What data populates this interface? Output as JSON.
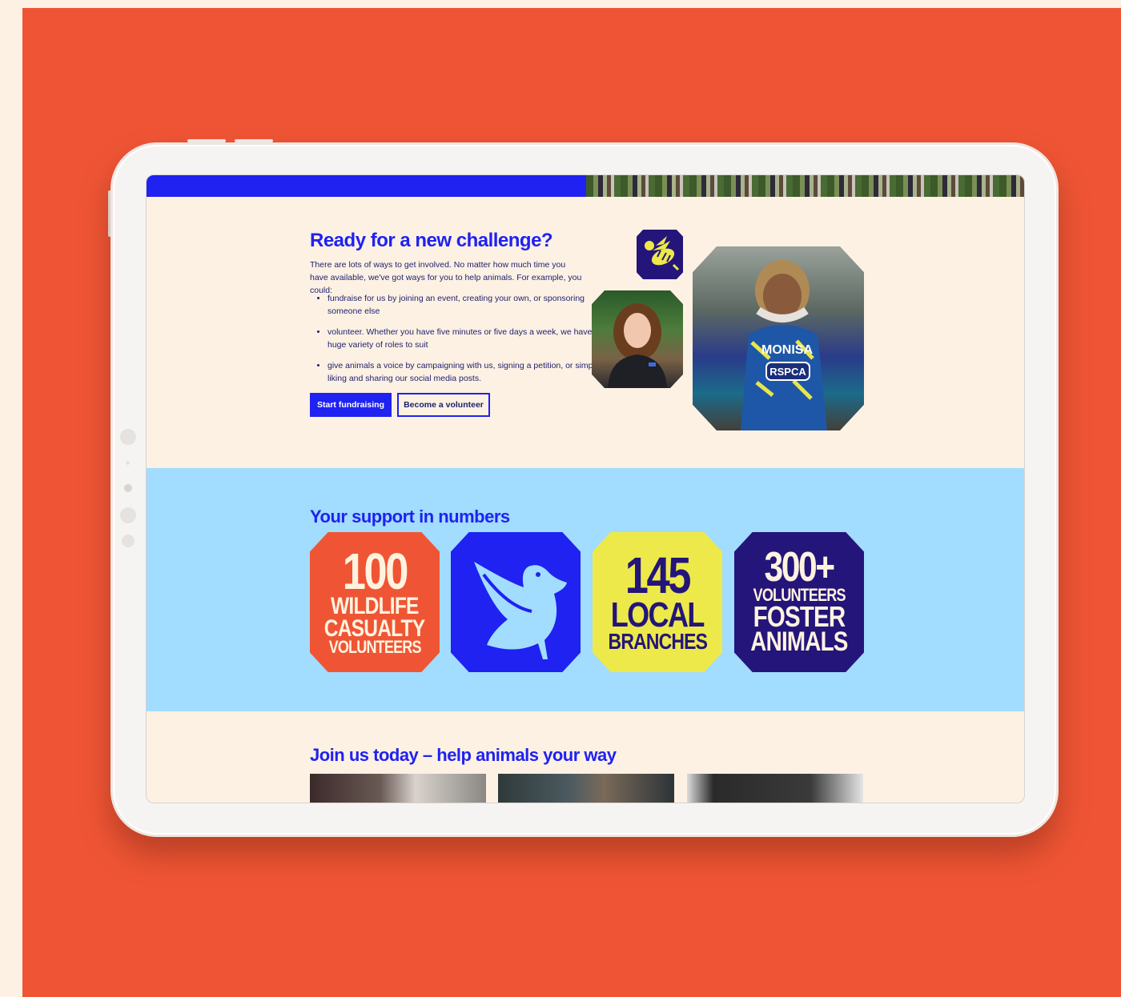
{
  "colors": {
    "background_cream": "#fdf1e3",
    "stage_orange": "#ef5535",
    "brand_blue": "#1f22f1",
    "navy": "#24157a",
    "sky_blue": "#a2dcfe",
    "yellow": "#ede94a"
  },
  "challenge": {
    "title": "Ready for a new challenge?",
    "intro": "There are lots of ways to get involved. No matter how much time you have available, we've got ways for you to help animals. For example, you could:",
    "bullets": [
      "fundraise for us by joining an event, creating your own, or sponsoring someone else",
      "volunteer. Whether you have five minutes or five days a week, we have a huge variety of roles to suit",
      "give animals a voice by campaigning with us, signing a petition, or simply liking and sharing our social media posts."
    ],
    "primary_button": "Start fundraising",
    "secondary_button": "Become a volunteer",
    "runner_vest_name": "MONISA",
    "runner_vest_logo": "RSPCA"
  },
  "numbers": {
    "title": "Your support in numbers",
    "tiles": [
      {
        "big": "100",
        "lines": [
          "WILDLIFE",
          "CASUALTY",
          "VOLUNTEERS"
        ]
      },
      {
        "icon": "bird-icon"
      },
      {
        "big": "145",
        "lines": [
          "LOCAL",
          "BRANCHES"
        ]
      },
      {
        "big": "300+",
        "lines": [
          "VOLUNTEERS",
          "FOSTER",
          "ANIMALS"
        ]
      }
    ]
  },
  "join": {
    "title": "Join us today – help animals your way"
  }
}
